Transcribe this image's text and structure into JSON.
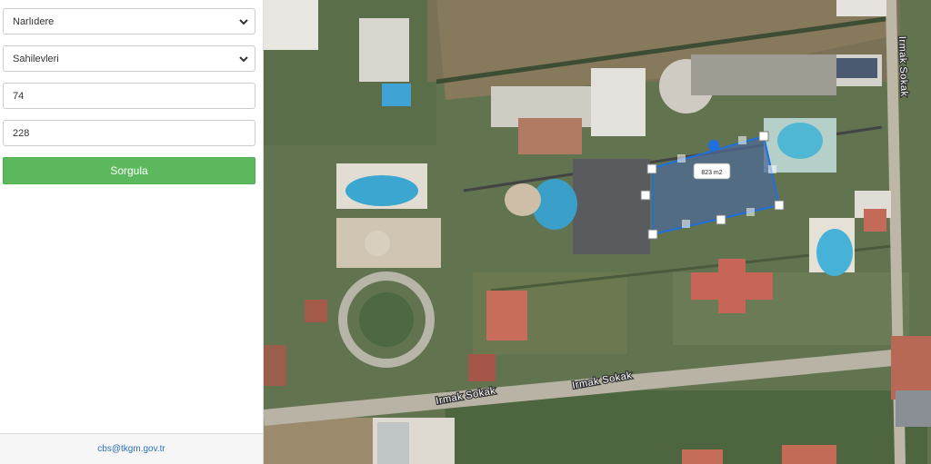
{
  "form": {
    "district": "Narlıdere",
    "neighborhood": "Sahilevleri",
    "block": "74",
    "parcel": "228",
    "submit_label": "Sorgula"
  },
  "footer": {
    "email": "cbs@tkgm.gov.tr"
  },
  "map": {
    "parcel_area": "823 m2",
    "streets": [
      "Irmak Sokak",
      "Irmak Sokak",
      "Irmak Sokak"
    ],
    "highlight_color": "#1f6fe0"
  }
}
